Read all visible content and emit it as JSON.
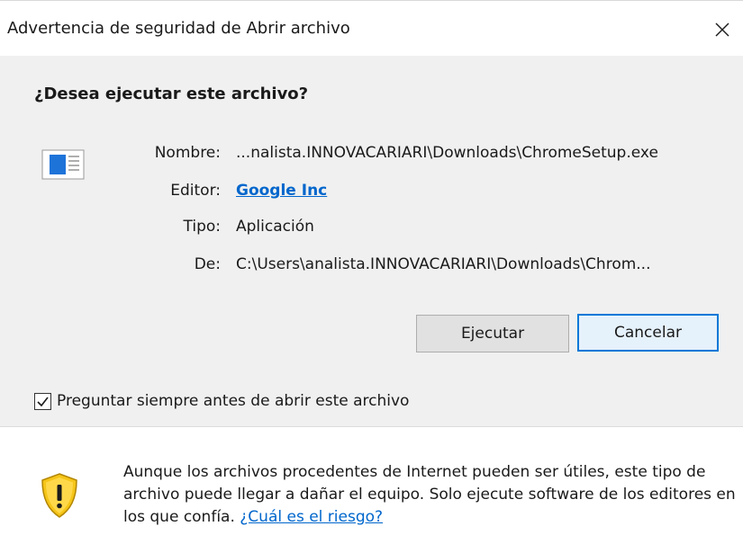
{
  "window": {
    "title": "Advertencia de seguridad de Abrir archivo",
    "close_glyph": "✕"
  },
  "question": "¿Desea ejecutar este archivo?",
  "file_info": {
    "icon": "application-window-icon",
    "rows": [
      {
        "label": "Nombre:",
        "value": "...nalista.INNOVACARIARI\\Downloads\\ChromeSetup.exe"
      },
      {
        "label": "Editor:",
        "value": "Google Inc"
      },
      {
        "label": "Tipo:",
        "value": "Aplicación"
      },
      {
        "label": "De:",
        "value": "C:\\Users\\analista.INNOVACARIARI\\Downloads\\Chrom..."
      }
    ]
  },
  "buttons": {
    "run": "Ejecutar",
    "cancel": "Cancelar"
  },
  "checkbox": {
    "label": "Preguntar siempre antes de abrir este archivo",
    "checked": true
  },
  "warning": {
    "icon": "shield-warning-icon",
    "text": "Aunque los archivos procedentes de Internet pueden ser útiles, este tipo de archivo puede llegar a dañar el equipo. Solo ejecute software de los editores en los que confía.",
    "link": "¿Cuál es el riesgo?"
  },
  "colors": {
    "link": "#0066cc",
    "accent_border": "#0078d7",
    "content_bg": "#f0f0f0",
    "shield_yellow": "#f5c518"
  }
}
